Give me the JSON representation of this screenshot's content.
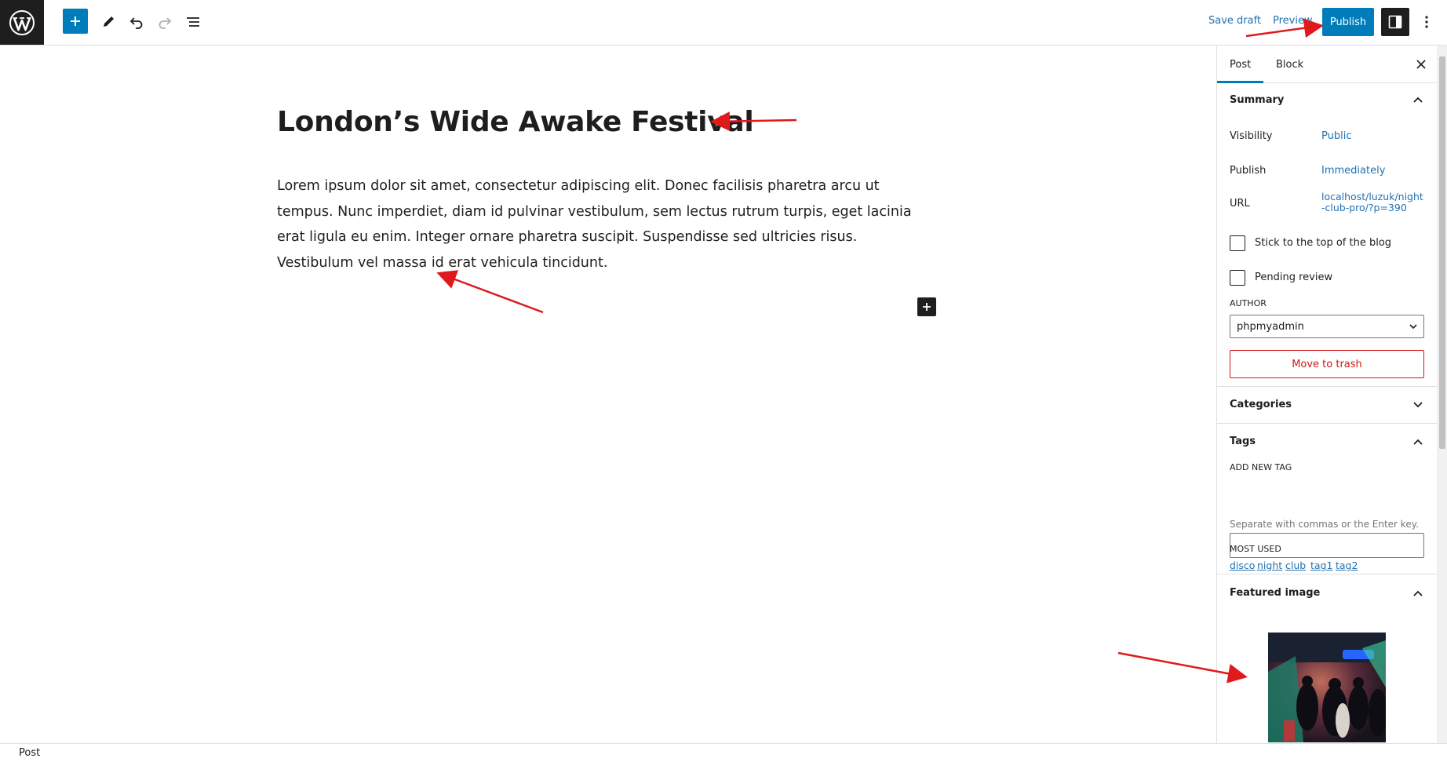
{
  "toolbar": {
    "wp_logo_icon": "wordpress-icon",
    "save_draft": "Save draft",
    "preview": "Preview",
    "publish": "Publish"
  },
  "editor": {
    "title": "London’s Wide Awake Festival",
    "body": "Lorem ipsum dolor sit amet, consectetur adipiscing elit. Donec facilisis pharetra arcu ut tempus. Nunc imperdiet, diam id pulvinar vestibulum, sem lectus rutrum turpis, eget lacinia erat ligula eu enim. Integer ornare pharetra suscipit. Suspendisse sed ultricies risus. Vestibulum vel massa id erat vehicula tincidunt."
  },
  "sidebar": {
    "tabs": [
      {
        "label": "Post",
        "active": true
      },
      {
        "label": "Block",
        "active": false
      }
    ],
    "summary": {
      "heading": "Summary",
      "visibility_label": "Visibility",
      "visibility_value": "Public",
      "publish_label": "Publish",
      "publish_value": "Immediately",
      "url_label": "URL",
      "url_value": "localhost/luzuk/night-club-pro/?p=390",
      "sticky_label": "Stick to the top of the blog",
      "sticky_checked": false,
      "pending_label": "Pending review",
      "pending_checked": false,
      "author_label": "AUTHOR",
      "author_value": "phpmyadmin",
      "trash_label": "Move to trash"
    },
    "categories": {
      "heading": "Categories"
    },
    "tags": {
      "heading": "Tags",
      "add_label": "ADD NEW TAG",
      "input_value": "",
      "help": "Separate with commas or the Enter key.",
      "most_used_label": "MOST USED",
      "most_used": [
        "disco",
        "night",
        "club",
        "tag1",
        "tag2"
      ]
    },
    "featured_image": {
      "heading": "Featured image"
    }
  },
  "footer": {
    "breadcrumb": "Post"
  },
  "colors": {
    "accent": "#007cba",
    "link": "#2271b1",
    "danger": "#cc1818",
    "dark": "#1e1e1e",
    "annotation": "#e0191d"
  }
}
